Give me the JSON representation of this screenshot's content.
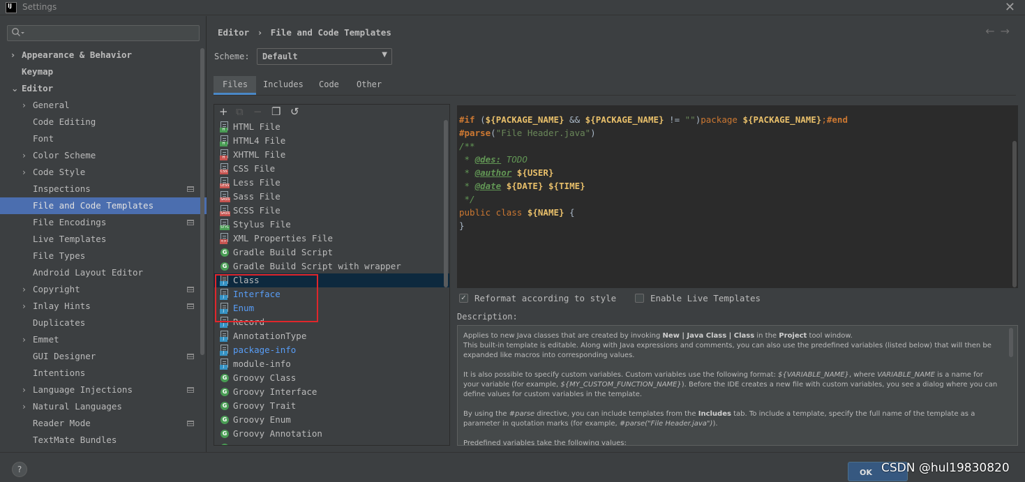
{
  "window": {
    "title": "Settings",
    "logo_text": "IJ"
  },
  "sidebar": {
    "items": [
      {
        "label": "Appearance & Behavior",
        "level": 0,
        "arrow": "›",
        "bold": true
      },
      {
        "label": "Keymap",
        "level": 0,
        "arrow": "",
        "bold": true
      },
      {
        "label": "Editor",
        "level": 0,
        "arrow": "⌄",
        "bold": true
      },
      {
        "label": "General",
        "level": 1,
        "arrow": "›"
      },
      {
        "label": "Code Editing",
        "level": 1,
        "arrow": ""
      },
      {
        "label": "Font",
        "level": 1,
        "arrow": ""
      },
      {
        "label": "Color Scheme",
        "level": 1,
        "arrow": "›"
      },
      {
        "label": "Code Style",
        "level": 1,
        "arrow": "›"
      },
      {
        "label": "Inspections",
        "level": 1,
        "arrow": "",
        "project": true
      },
      {
        "label": "File and Code Templates",
        "level": 1,
        "arrow": "",
        "selected": true
      },
      {
        "label": "File Encodings",
        "level": 1,
        "arrow": "",
        "project": true
      },
      {
        "label": "Live Templates",
        "level": 1,
        "arrow": ""
      },
      {
        "label": "File Types",
        "level": 1,
        "arrow": ""
      },
      {
        "label": "Android Layout Editor",
        "level": 1,
        "arrow": ""
      },
      {
        "label": "Copyright",
        "level": 1,
        "arrow": "›",
        "project": true
      },
      {
        "label": "Inlay Hints",
        "level": 1,
        "arrow": "›",
        "project": true
      },
      {
        "label": "Duplicates",
        "level": 1,
        "arrow": ""
      },
      {
        "label": "Emmet",
        "level": 1,
        "arrow": "›"
      },
      {
        "label": "GUI Designer",
        "level": 1,
        "arrow": "",
        "project": true
      },
      {
        "label": "Intentions",
        "level": 1,
        "arrow": ""
      },
      {
        "label": "Language Injections",
        "level": 1,
        "arrow": "›",
        "project": true
      },
      {
        "label": "Natural Languages",
        "level": 1,
        "arrow": "›"
      },
      {
        "label": "Reader Mode",
        "level": 1,
        "arrow": "",
        "project": true
      },
      {
        "label": "TextMate Bundles",
        "level": 1,
        "arrow": ""
      }
    ]
  },
  "header": {
    "crumb_parent": "Editor",
    "crumb_sep": "›",
    "crumb_current": "File and Code Templates",
    "back_icon": "←",
    "forward_icon": "→"
  },
  "scheme": {
    "label": "Scheme:",
    "value": "Default"
  },
  "tabs": [
    {
      "label": "Files",
      "active": true
    },
    {
      "label": "Includes"
    },
    {
      "label": "Code"
    },
    {
      "label": "Other"
    }
  ],
  "toolbar": {
    "add": "+",
    "copy": "⧉",
    "remove": "−",
    "duplicate": "❐",
    "reset": "↺"
  },
  "templates": [
    {
      "label": "HTML File",
      "icon": "file",
      "tag": "H",
      "tag_color": "#499c54"
    },
    {
      "label": "HTML4 File",
      "icon": "file",
      "tag": "H",
      "tag_color": "#499c54"
    },
    {
      "label": "XHTML File",
      "icon": "file",
      "tag": "H",
      "tag_color": "#c75450"
    },
    {
      "label": "CSS File",
      "icon": "file",
      "tag": "CSS",
      "tag_color": "#c75450"
    },
    {
      "label": "Less File",
      "icon": "file",
      "tag": "LESS",
      "tag_color": "#c75450"
    },
    {
      "label": "Sass File",
      "icon": "file",
      "tag": "SASS",
      "tag_color": "#c75450"
    },
    {
      "label": "SCSS File",
      "icon": "file",
      "tag": "SASS",
      "tag_color": "#c75450"
    },
    {
      "label": "Stylus File",
      "icon": "file",
      "tag": "STYL",
      "tag_color": "#499c54"
    },
    {
      "label": "XML Properties File",
      "icon": "file",
      "tag": "<>",
      "tag_color": "#c75450"
    },
    {
      "label": "Gradle Build Script",
      "icon": "gradle",
      "tag": "G"
    },
    {
      "label": "Gradle Build Script with wrapper",
      "icon": "gradle",
      "tag": "G"
    },
    {
      "label": "Class",
      "icon": "file",
      "tag": "J",
      "tag_color": "#3592c4",
      "selected": true
    },
    {
      "label": "Interface",
      "icon": "file",
      "tag": "J",
      "tag_color": "#3592c4",
      "blue": true
    },
    {
      "label": "Enum",
      "icon": "file",
      "tag": "J",
      "tag_color": "#3592c4",
      "blue": true
    },
    {
      "label": "Record",
      "icon": "file",
      "tag": "J",
      "tag_color": "#3592c4"
    },
    {
      "label": "AnnotationType",
      "icon": "file",
      "tag": "J",
      "tag_color": "#3592c4"
    },
    {
      "label": "package-info",
      "icon": "file",
      "tag": "J",
      "tag_color": "#3592c4",
      "blue": true
    },
    {
      "label": "module-info",
      "icon": "file",
      "tag": "J",
      "tag_color": "#3592c4"
    },
    {
      "label": "Groovy Class",
      "icon": "gradle",
      "tag": "G"
    },
    {
      "label": "Groovy Interface",
      "icon": "gradle",
      "tag": "G"
    },
    {
      "label": "Groovy Trait",
      "icon": "gradle",
      "tag": "G"
    },
    {
      "label": "Groovy Enum",
      "icon": "gradle",
      "tag": "G"
    },
    {
      "label": "Groovy Annotation",
      "icon": "gradle",
      "tag": "G"
    },
    {
      "label": "",
      "icon": "gradle",
      "tag": "G"
    }
  ],
  "editor": {
    "lines": [
      [
        {
          "t": "#if",
          "c": "dir"
        },
        {
          "t": " (",
          "c": "var"
        },
        {
          "t": "${PACKAGE_NAME}",
          "c": "vb"
        },
        {
          "t": " && ",
          "c": "var"
        },
        {
          "t": "${PACKAGE_NAME}",
          "c": "vb"
        },
        {
          "t": " != ",
          "c": "var"
        },
        {
          "t": "\"\"",
          "c": "str"
        },
        {
          "t": ")",
          "c": "var"
        },
        {
          "t": "package ",
          "c": "kw"
        },
        {
          "t": "${PACKAGE_NAME}",
          "c": "vb"
        },
        {
          "t": ";",
          "c": "kw"
        },
        {
          "t": "#end",
          "c": "dir"
        }
      ],
      [
        {
          "t": "#parse",
          "c": "dir"
        },
        {
          "t": "(",
          "c": "var"
        },
        {
          "t": "\"File Header.java\"",
          "c": "str"
        },
        {
          "t": ")",
          "c": "var"
        }
      ],
      [
        {
          "t": "/**",
          "c": "cm"
        }
      ],
      [
        {
          "t": " * ",
          "c": "cm"
        },
        {
          "t": "@des:",
          "c": "tagc"
        },
        {
          "t": " TODO",
          "c": "cm"
        }
      ],
      [
        {
          "t": " * ",
          "c": "cm"
        },
        {
          "t": "@author",
          "c": "tagc"
        },
        {
          "t": " ",
          "c": "cm"
        },
        {
          "t": "${USER}",
          "c": "vb"
        }
      ],
      [
        {
          "t": " * ",
          "c": "cm"
        },
        {
          "t": "@date",
          "c": "tagc"
        },
        {
          "t": " ",
          "c": "cm"
        },
        {
          "t": "${DATE}",
          "c": "vb"
        },
        {
          "t": " ",
          "c": "cm"
        },
        {
          "t": "${TIME}",
          "c": "vb"
        }
      ],
      [
        {
          "t": " */",
          "c": "cm"
        }
      ],
      [
        {
          "t": "public class ",
          "c": "kw"
        },
        {
          "t": "${NAME}",
          "c": "vb"
        },
        {
          "t": " {",
          "c": "var"
        }
      ],
      [
        {
          "t": "}",
          "c": "var"
        }
      ]
    ]
  },
  "options": {
    "reformat_label": "Reformat according to style",
    "reformat_checked": true,
    "live_label": "Enable Live Templates",
    "live_checked": false,
    "check_mark": "✓"
  },
  "description": {
    "label": "Description:",
    "html": "<p>Applies to new Java classes that are created by invoking <b>New | Java Class | Class</b> in the <b>Project</b> tool window.<br>This built-in template is editable. Along with Java expressions and comments, you can also use the predefined variables (listed below) that will then be expanded like macros into corresponding values.</p><p>It is also possible to specify custom variables. Custom variables use the following format: <i>${VARIABLE_NAME}</i>, where <i>VARIABLE_NAME</i> is a name for your variable (for example, <i>${MY_CUSTOM_FUNCTION_NAME}</i>). Before the IDE creates a new file with custom variables, you see a dialog where you can define values for custom variables in the template.</p><p>By using the <i>#parse</i> directive, you can include templates from the <b>Includes</b> tab. To include a template, specify the full name of the template as a parameter in quotation marks (for example, <i>#parse(\"File Header.java\")</i>).</p><p>Predefined variables take the following values:</p>"
  },
  "footer": {
    "help": "?",
    "ok": "OK",
    "watermark": "CSDN @hul19830820"
  }
}
